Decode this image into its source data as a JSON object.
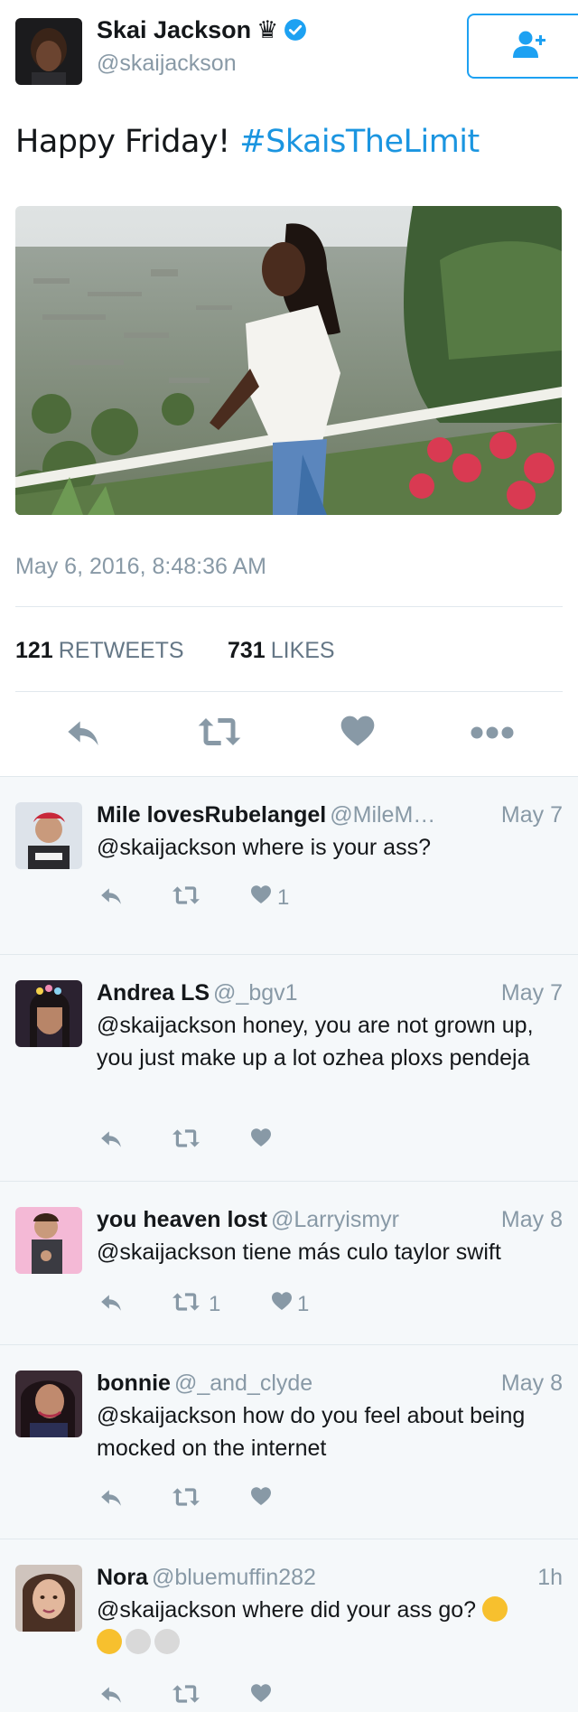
{
  "tweet": {
    "author_name": "Skai Jackson",
    "author_badge": "♛",
    "author_handle": "@skaijackson",
    "text": "Happy Friday! ",
    "hashtag": "#SkaisTheLimit",
    "timestamp": "May 6, 2016, 8:48:36 AM",
    "retweets_count": "121",
    "retweets_label": "RETWEETS",
    "likes_count": "731",
    "likes_label": "LIKES",
    "verified": true
  },
  "replies": [
    {
      "name": "Mile lovesRubelangel",
      "handle": "@MileM…",
      "date": "May 7",
      "text": "@skaijackson where is your ass?",
      "retweets": "",
      "likes": "1"
    },
    {
      "name": "Andrea LS",
      "handle": "@_bgv1",
      "date": "May 7",
      "text": "@skaijackson honey, you are not grown up, you just make up a lot ozhea ploxs pendeja",
      "retweets": "",
      "likes": ""
    },
    {
      "name": "you heaven lost",
      "handle": "@Larryismyr",
      "date": "May 8",
      "text": "@skaijackson tiene más culo taylor swift",
      "retweets": "1",
      "likes": "1"
    },
    {
      "name": "bonnie",
      "handle": "@_and_clyde",
      "date": "May 8",
      "text": "@skaijackson how do you feel about being mocked on the internet",
      "retweets": "",
      "likes": ""
    },
    {
      "name": "Nora",
      "handle": "@bluemuffin282",
      "date": "1h",
      "text": "@skaijackson where did your ass go?",
      "emojis": [
        "face-with-tears-of-joy",
        "face-with-tears-of-joy",
        "skull",
        "skull"
      ],
      "retweets": "",
      "likes": ""
    }
  ],
  "icons": [
    "follow-user-icon",
    "verified-badge-icon",
    "reply-icon",
    "retweet-icon",
    "like-icon",
    "more-icon"
  ],
  "colors": {
    "accent": "#1da1f2",
    "hashtag": "#1b95e0",
    "muted": "#8899a6",
    "icon": "#8899a6",
    "background": "#f5f8fa"
  }
}
